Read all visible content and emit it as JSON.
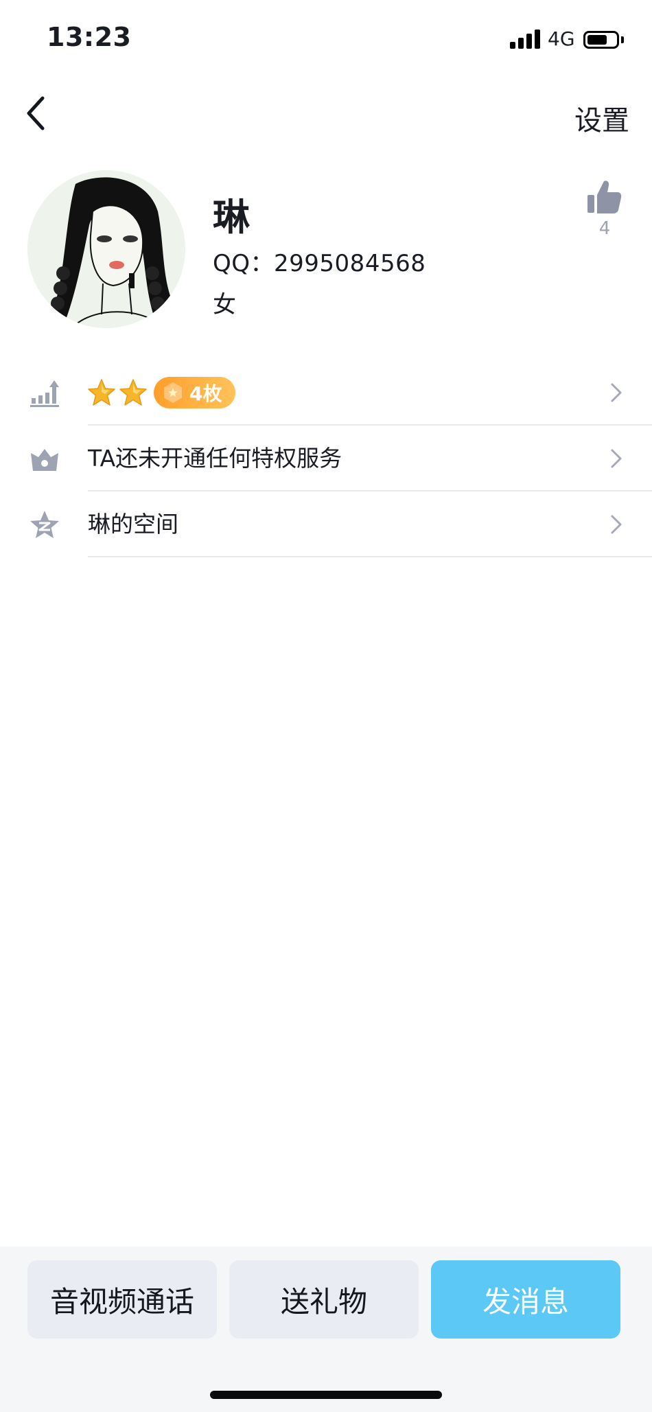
{
  "status_bar": {
    "time": "13:23",
    "network": "4G",
    "battery_level": 0.7
  },
  "nav": {
    "back_icon": "chevron-left-icon",
    "settings_label": "设置"
  },
  "profile": {
    "name": "琳",
    "qq": "QQ：2995084568",
    "gender": "女",
    "like_count": "4",
    "like_icon": "thumbs-up-icon",
    "avatar_icon": "avatar-illustration"
  },
  "list": {
    "level_row": {
      "icon": "level-up-icon",
      "stars": 2,
      "badge_text": "4枚"
    },
    "privilege_row": {
      "icon": "crown-icon",
      "label": "TA还未开通任何特权服务"
    },
    "space_row": {
      "icon": "qzone-star-icon",
      "label": "琳的空间"
    }
  },
  "actions": {
    "call": "音视频通话",
    "gift": "送礼物",
    "message": "发消息"
  },
  "colors": {
    "accent_blue": "#5bc8f6",
    "badge_orange": "#ff9e2a",
    "icon_gray": "#9ea3b4",
    "star_gold": "#f7b52b"
  }
}
